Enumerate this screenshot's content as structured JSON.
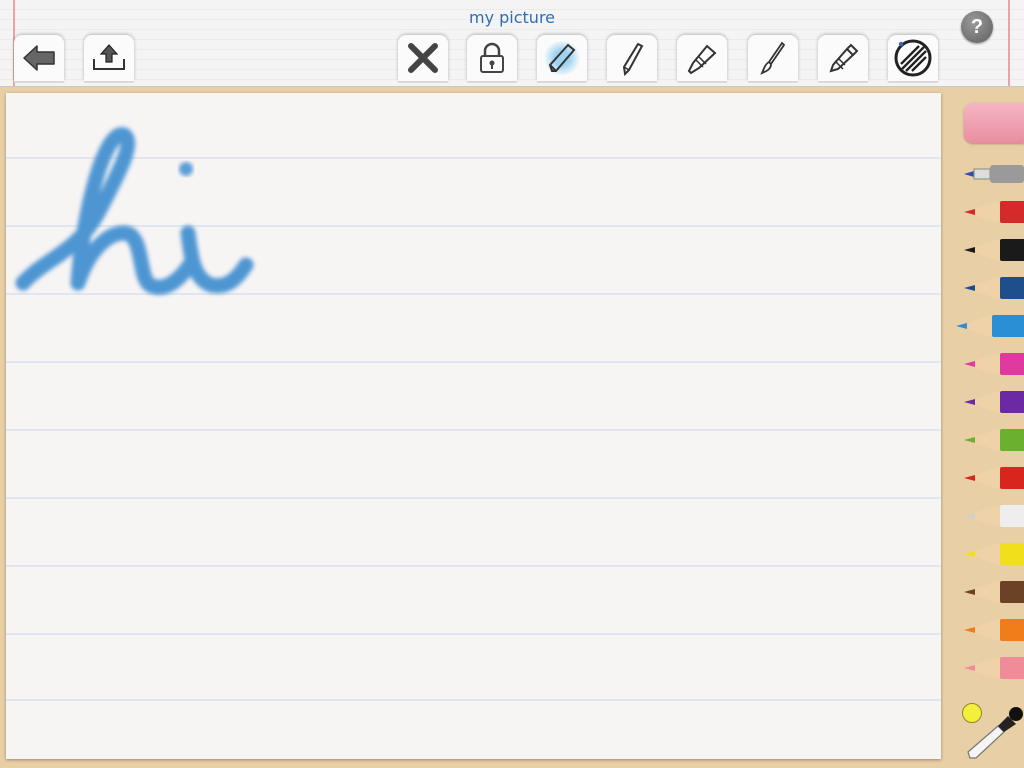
{
  "window": {
    "title": "my picture"
  },
  "help": {
    "label": "?"
  },
  "toolbar": {
    "back": {
      "icon": "back-arrow-icon"
    },
    "share": {
      "icon": "upload-tray-icon"
    },
    "tools": [
      {
        "id": "clear",
        "icon": "clear-x-icon"
      },
      {
        "id": "lock",
        "icon": "padlock-icon"
      },
      {
        "id": "crayon",
        "icon": "crayon-icon",
        "active": true
      },
      {
        "id": "pencil",
        "icon": "pencil-icon"
      },
      {
        "id": "highlighter",
        "icon": "highlighter-icon"
      },
      {
        "id": "brush",
        "icon": "paintbrush-icon"
      },
      {
        "id": "marker",
        "icon": "marker-icon"
      },
      {
        "id": "fill",
        "icon": "scribble-fill-icon"
      }
    ]
  },
  "canvas": {
    "drawing_text": "hi",
    "stroke_color": "#3f8fd0",
    "line_color": "#dfe5f1",
    "margin_color": "#e9a4a4"
  },
  "palette": {
    "eraser_color": "#ee9bab",
    "marker_color": "#2b4fa8",
    "pencils": [
      {
        "name": "red",
        "color": "#d42a2a"
      },
      {
        "name": "black",
        "color": "#1a1a1a"
      },
      {
        "name": "navy",
        "color": "#1f4e8c"
      },
      {
        "name": "sky-blue",
        "color": "#2a8fd4",
        "selected": true
      },
      {
        "name": "magenta",
        "color": "#e03aa0"
      },
      {
        "name": "purple",
        "color": "#6a2aa3"
      },
      {
        "name": "green",
        "color": "#6bb02e"
      },
      {
        "name": "red-orange",
        "color": "#d8261e"
      },
      {
        "name": "white",
        "color": "#eeeeee"
      },
      {
        "name": "yellow",
        "color": "#f2df1c"
      },
      {
        "name": "brown",
        "color": "#6b4226"
      },
      {
        "name": "orange",
        "color": "#f07c1a"
      },
      {
        "name": "pink",
        "color": "#f08c9a"
      }
    ],
    "current_color": "#f3ef3a"
  }
}
